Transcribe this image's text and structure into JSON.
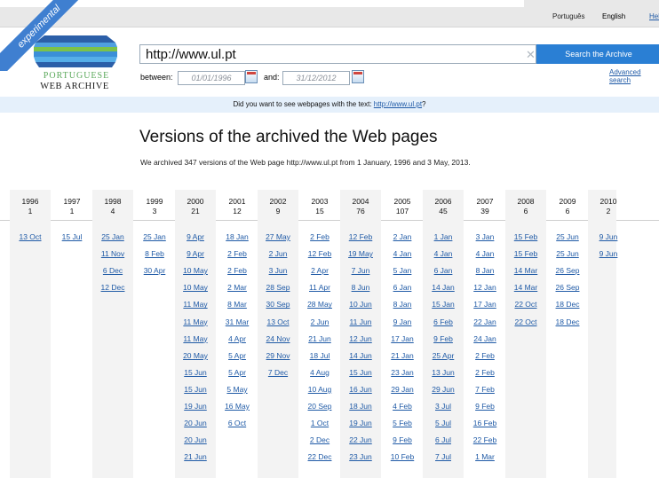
{
  "top_langs": {
    "portugues": "Português",
    "english": "English",
    "help": "Help"
  },
  "logo": {
    "ribbon": "experimental",
    "line1": "PORTUGUESE",
    "line2": "WEB ARCHIVE"
  },
  "search": {
    "url_value": "http://www.ul.pt",
    "button": "Search the Archive",
    "advanced": "Advanced search"
  },
  "dates": {
    "between_label": "between:",
    "from": "01/01/1996",
    "and_label": "and:",
    "to": "31/12/2012"
  },
  "suggest": {
    "prefix": "Did you want to see webpages with the text: ",
    "link": "http://www.ul.pt",
    "suffix": "?"
  },
  "main": {
    "title": "Versions of the archived the Web pages",
    "subtitle": "We archived 347 versions of the Web page http://www.ul.pt from 1 January, 1996 and 3 May, 2013."
  },
  "years": [
    {
      "year": "1996",
      "count": "1",
      "dates": [
        "13 Oct"
      ]
    },
    {
      "year": "1997",
      "count": "1",
      "dates": [
        "15 Jul"
      ]
    },
    {
      "year": "1998",
      "count": "4",
      "dates": [
        "25 Jan",
        "11 Nov",
        "6 Dec",
        "12 Dec"
      ]
    },
    {
      "year": "1999",
      "count": "3",
      "dates": [
        "25 Jan",
        "8 Feb",
        "30 Apr"
      ]
    },
    {
      "year": "2000",
      "count": "21",
      "dates": [
        "9 Apr",
        "9 Apr",
        "10 May",
        "10 May",
        "11 May",
        "11 May",
        "11 May",
        "20 May",
        "15 Jun",
        "15 Jun",
        "19 Jun",
        "20 Jun",
        "20 Jun",
        "21 Jun"
      ]
    },
    {
      "year": "2001",
      "count": "12",
      "dates": [
        "18 Jan",
        "2 Feb",
        "2 Feb",
        "2 Mar",
        "8 Mar",
        "31 Mar",
        "4 Apr",
        "5 Apr",
        "5 Apr",
        "5 May",
        "16 May",
        "6 Oct"
      ]
    },
    {
      "year": "2002",
      "count": "9",
      "dates": [
        "27 May",
        "2 Jun",
        "3 Jun",
        "28 Sep",
        "30 Sep",
        "13 Oct",
        "24 Nov",
        "29 Nov",
        "7 Dec"
      ]
    },
    {
      "year": "2003",
      "count": "15",
      "dates": [
        "2 Feb",
        "12 Feb",
        "2 Apr",
        "11 Apr",
        "28 May",
        "2 Jun",
        "21 Jun",
        "18 Jul",
        "4 Aug",
        "10 Aug",
        "20 Sep",
        "1 Oct",
        "2 Dec",
        "22 Dec"
      ]
    },
    {
      "year": "2004",
      "count": "76",
      "dates": [
        "12 Feb",
        "19 May",
        "7 Jun",
        "8 Jun",
        "10 Jun",
        "11 Jun",
        "12 Jun",
        "14 Jun",
        "15 Jun",
        "16 Jun",
        "18 Jun",
        "19 Jun",
        "22 Jun",
        "23 Jun"
      ]
    },
    {
      "year": "2005",
      "count": "107",
      "dates": [
        "2 Jan",
        "4 Jan",
        "5 Jan",
        "6 Jan",
        "8 Jan",
        "9 Jan",
        "17 Jan",
        "21 Jan",
        "23 Jan",
        "29 Jan",
        "4 Feb",
        "5 Feb",
        "9 Feb",
        "10 Feb"
      ]
    },
    {
      "year": "2006",
      "count": "45",
      "dates": [
        "1 Jan",
        "4 Jan",
        "6 Jan",
        "14 Jan",
        "15 Jan",
        "6 Feb",
        "9 Feb",
        "25 Apr",
        "13 Jun",
        "29 Jun",
        "3 Jul",
        "5 Jul",
        "6 Jul",
        "7 Jul"
      ]
    },
    {
      "year": "2007",
      "count": "39",
      "dates": [
        "3 Jan",
        "4 Jan",
        "8 Jan",
        "12 Jan",
        "17 Jan",
        "22 Jan",
        "24 Jan",
        "2 Feb",
        "2 Feb",
        "7 Feb",
        "9 Feb",
        "16 Feb",
        "22 Feb",
        "1 Mar"
      ]
    },
    {
      "year": "2008",
      "count": "6",
      "dates": [
        "15 Feb",
        "15 Feb",
        "14 Mar",
        "14 Mar",
        "22 Oct",
        "22 Oct"
      ]
    },
    {
      "year": "2009",
      "count": "6",
      "dates": [
        "25 Jun",
        "25 Jun",
        "26 Sep",
        "26 Sep",
        "18 Dec",
        "18 Dec"
      ]
    },
    {
      "year": "2010",
      "count": "2",
      "dates": [
        "9 Jun",
        "9 Jun"
      ]
    }
  ]
}
